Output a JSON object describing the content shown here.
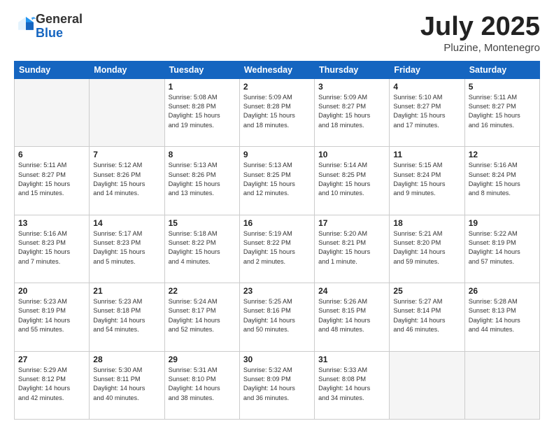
{
  "header": {
    "logo_general": "General",
    "logo_blue": "Blue",
    "month": "July 2025",
    "location": "Pluzine, Montenegro"
  },
  "weekdays": [
    "Sunday",
    "Monday",
    "Tuesday",
    "Wednesday",
    "Thursday",
    "Friday",
    "Saturday"
  ],
  "weeks": [
    [
      {
        "day": "",
        "info": ""
      },
      {
        "day": "",
        "info": ""
      },
      {
        "day": "1",
        "info": "Sunrise: 5:08 AM\nSunset: 8:28 PM\nDaylight: 15 hours\nand 19 minutes."
      },
      {
        "day": "2",
        "info": "Sunrise: 5:09 AM\nSunset: 8:28 PM\nDaylight: 15 hours\nand 18 minutes."
      },
      {
        "day": "3",
        "info": "Sunrise: 5:09 AM\nSunset: 8:27 PM\nDaylight: 15 hours\nand 18 minutes."
      },
      {
        "day": "4",
        "info": "Sunrise: 5:10 AM\nSunset: 8:27 PM\nDaylight: 15 hours\nand 17 minutes."
      },
      {
        "day": "5",
        "info": "Sunrise: 5:11 AM\nSunset: 8:27 PM\nDaylight: 15 hours\nand 16 minutes."
      }
    ],
    [
      {
        "day": "6",
        "info": "Sunrise: 5:11 AM\nSunset: 8:27 PM\nDaylight: 15 hours\nand 15 minutes."
      },
      {
        "day": "7",
        "info": "Sunrise: 5:12 AM\nSunset: 8:26 PM\nDaylight: 15 hours\nand 14 minutes."
      },
      {
        "day": "8",
        "info": "Sunrise: 5:13 AM\nSunset: 8:26 PM\nDaylight: 15 hours\nand 13 minutes."
      },
      {
        "day": "9",
        "info": "Sunrise: 5:13 AM\nSunset: 8:25 PM\nDaylight: 15 hours\nand 12 minutes."
      },
      {
        "day": "10",
        "info": "Sunrise: 5:14 AM\nSunset: 8:25 PM\nDaylight: 15 hours\nand 10 minutes."
      },
      {
        "day": "11",
        "info": "Sunrise: 5:15 AM\nSunset: 8:24 PM\nDaylight: 15 hours\nand 9 minutes."
      },
      {
        "day": "12",
        "info": "Sunrise: 5:16 AM\nSunset: 8:24 PM\nDaylight: 15 hours\nand 8 minutes."
      }
    ],
    [
      {
        "day": "13",
        "info": "Sunrise: 5:16 AM\nSunset: 8:23 PM\nDaylight: 15 hours\nand 7 minutes."
      },
      {
        "day": "14",
        "info": "Sunrise: 5:17 AM\nSunset: 8:23 PM\nDaylight: 15 hours\nand 5 minutes."
      },
      {
        "day": "15",
        "info": "Sunrise: 5:18 AM\nSunset: 8:22 PM\nDaylight: 15 hours\nand 4 minutes."
      },
      {
        "day": "16",
        "info": "Sunrise: 5:19 AM\nSunset: 8:22 PM\nDaylight: 15 hours\nand 2 minutes."
      },
      {
        "day": "17",
        "info": "Sunrise: 5:20 AM\nSunset: 8:21 PM\nDaylight: 15 hours\nand 1 minute."
      },
      {
        "day": "18",
        "info": "Sunrise: 5:21 AM\nSunset: 8:20 PM\nDaylight: 14 hours\nand 59 minutes."
      },
      {
        "day": "19",
        "info": "Sunrise: 5:22 AM\nSunset: 8:19 PM\nDaylight: 14 hours\nand 57 minutes."
      }
    ],
    [
      {
        "day": "20",
        "info": "Sunrise: 5:23 AM\nSunset: 8:19 PM\nDaylight: 14 hours\nand 55 minutes."
      },
      {
        "day": "21",
        "info": "Sunrise: 5:23 AM\nSunset: 8:18 PM\nDaylight: 14 hours\nand 54 minutes."
      },
      {
        "day": "22",
        "info": "Sunrise: 5:24 AM\nSunset: 8:17 PM\nDaylight: 14 hours\nand 52 minutes."
      },
      {
        "day": "23",
        "info": "Sunrise: 5:25 AM\nSunset: 8:16 PM\nDaylight: 14 hours\nand 50 minutes."
      },
      {
        "day": "24",
        "info": "Sunrise: 5:26 AM\nSunset: 8:15 PM\nDaylight: 14 hours\nand 48 minutes."
      },
      {
        "day": "25",
        "info": "Sunrise: 5:27 AM\nSunset: 8:14 PM\nDaylight: 14 hours\nand 46 minutes."
      },
      {
        "day": "26",
        "info": "Sunrise: 5:28 AM\nSunset: 8:13 PM\nDaylight: 14 hours\nand 44 minutes."
      }
    ],
    [
      {
        "day": "27",
        "info": "Sunrise: 5:29 AM\nSunset: 8:12 PM\nDaylight: 14 hours\nand 42 minutes."
      },
      {
        "day": "28",
        "info": "Sunrise: 5:30 AM\nSunset: 8:11 PM\nDaylight: 14 hours\nand 40 minutes."
      },
      {
        "day": "29",
        "info": "Sunrise: 5:31 AM\nSunset: 8:10 PM\nDaylight: 14 hours\nand 38 minutes."
      },
      {
        "day": "30",
        "info": "Sunrise: 5:32 AM\nSunset: 8:09 PM\nDaylight: 14 hours\nand 36 minutes."
      },
      {
        "day": "31",
        "info": "Sunrise: 5:33 AM\nSunset: 8:08 PM\nDaylight: 14 hours\nand 34 minutes."
      },
      {
        "day": "",
        "info": ""
      },
      {
        "day": "",
        "info": ""
      }
    ]
  ]
}
